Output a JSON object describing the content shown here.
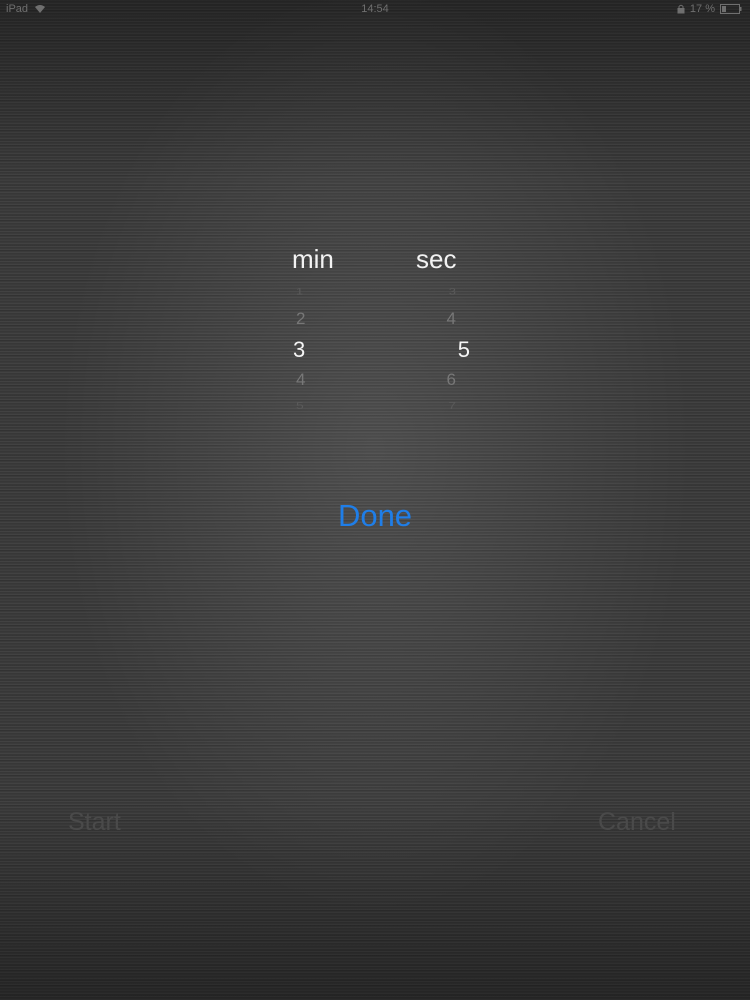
{
  "status_bar": {
    "carrier": "iPad",
    "time": "14:54",
    "battery_percent": "17 %",
    "icons": [
      "wifi-icon",
      "lock-icon",
      "battery-icon"
    ]
  },
  "picker": {
    "minutes_label": "min",
    "seconds_label": "sec",
    "minutes_values": [
      "1",
      "2",
      "3",
      "4",
      "5"
    ],
    "seconds_values": [
      "3",
      "4",
      "5",
      "6",
      "7"
    ],
    "selected_minutes": "3",
    "selected_seconds": "5"
  },
  "done_label": "Done",
  "start_label": "Start",
  "cancel_label": "Cancel",
  "colors": {
    "accent": "#1f7ee8",
    "background": "#3a3a3a",
    "disabled_text": "#4a4a4a"
  }
}
